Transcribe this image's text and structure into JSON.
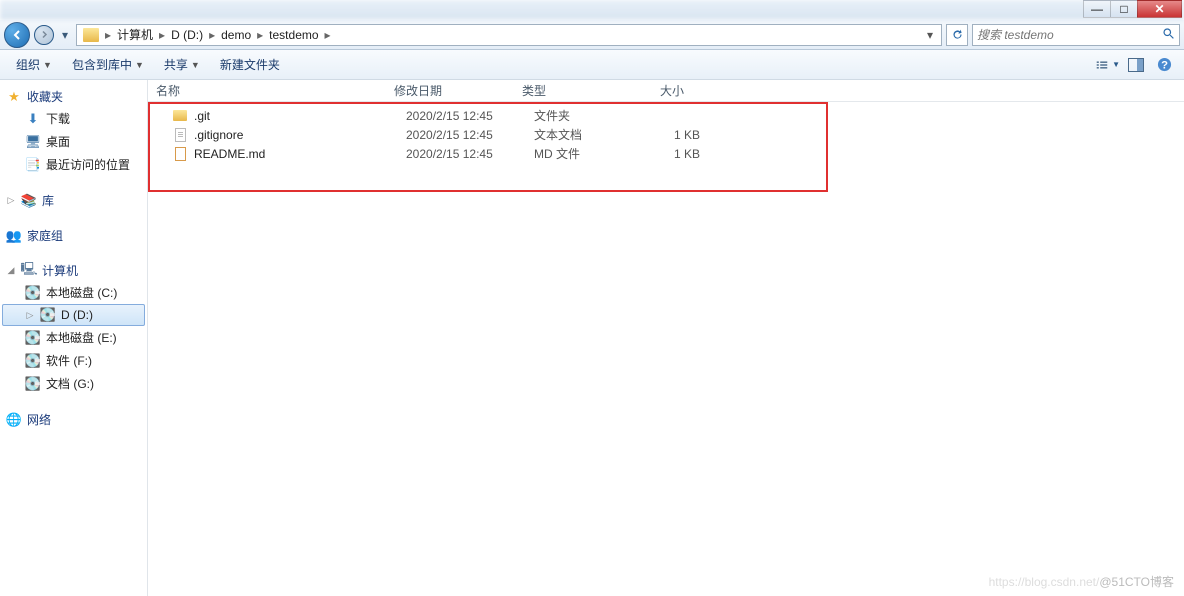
{
  "window_controls": {
    "min": "—",
    "max": "□",
    "close": "✕"
  },
  "nav": {
    "breadcrumb": [
      "计算机",
      "D (D:)",
      "demo",
      "testdemo"
    ],
    "search_placeholder": "搜索 testdemo"
  },
  "toolbar": {
    "organize": "组织",
    "include": "包含到库中",
    "share": "共享",
    "newfolder": "新建文件夹"
  },
  "sidebar": {
    "favorites": {
      "label": "收藏夹",
      "items": [
        "下载",
        "桌面",
        "最近访问的位置"
      ]
    },
    "libraries": {
      "label": "库"
    },
    "homegroup": {
      "label": "家庭组"
    },
    "computer": {
      "label": "计算机",
      "items": [
        "本地磁盘 (C:)",
        "D (D:)",
        "本地磁盘 (E:)",
        "软件 (F:)",
        "文档 (G:)"
      ]
    },
    "network": {
      "label": "网络"
    }
  },
  "columns": {
    "name": "名称",
    "date": "修改日期",
    "type": "类型",
    "size": "大小"
  },
  "files": [
    {
      "name": ".git",
      "date": "2020/2/15 12:45",
      "type": "文件夹",
      "size": "",
      "icon": "folder"
    },
    {
      "name": ".gitignore",
      "date": "2020/2/15 12:45",
      "type": "文本文档",
      "size": "1 KB",
      "icon": "text"
    },
    {
      "name": "README.md",
      "date": "2020/2/15 12:45",
      "type": "MD 文件",
      "size": "1 KB",
      "icon": "md"
    }
  ],
  "watermark": {
    "light": "https://blog.csdn.net/",
    "dark": "@51CTO博客"
  }
}
